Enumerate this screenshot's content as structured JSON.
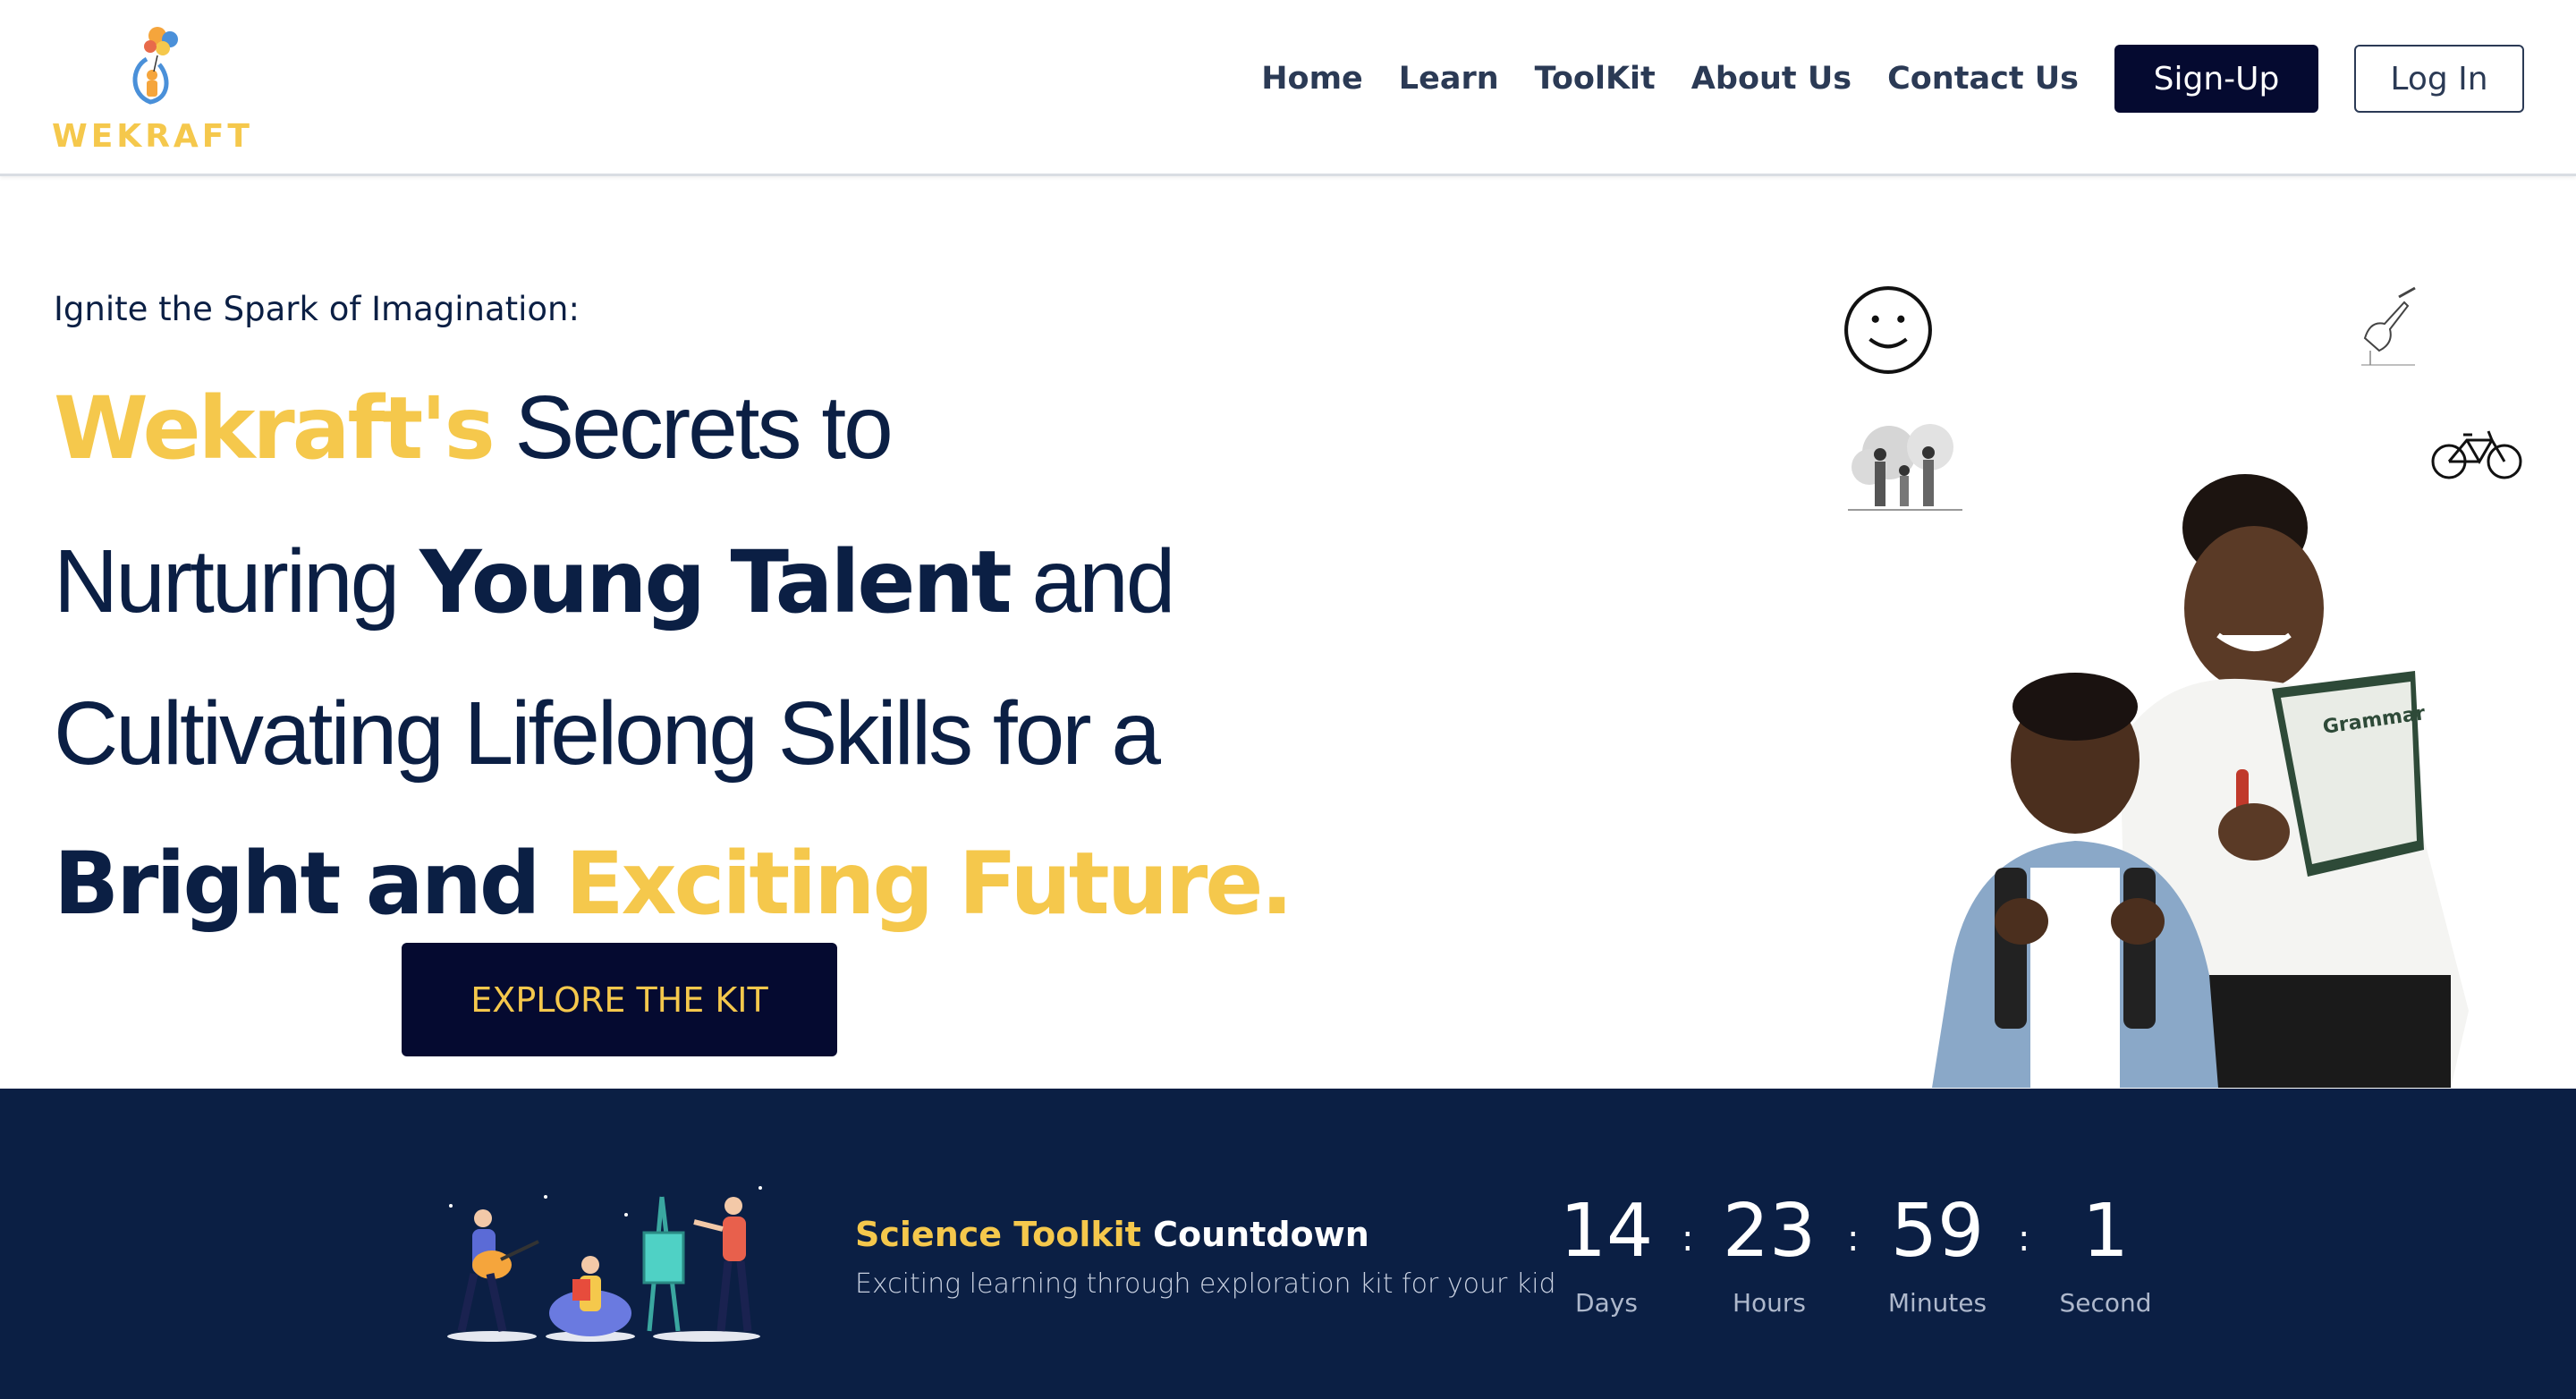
{
  "brand": {
    "name": "WEKRAFT",
    "logo_icon": "balloon-kid-icon"
  },
  "nav": {
    "links": [
      "Home",
      "Learn",
      "ToolKit",
      "About Us",
      "Contact Us"
    ],
    "signup_label": "Sign-Up",
    "login_label": "Log In"
  },
  "hero": {
    "tagline": "Ignite the Spark of Imagination:",
    "line1": {
      "highlight": "Wekraft's",
      "rest": " Secrets to"
    },
    "line2": {
      "prefix": "Nurturing ",
      "bold": "Young Talent",
      "suffix": " and"
    },
    "line3": "Cultivating Lifelong Skills for a",
    "line4": {
      "bold": "Bright and ",
      "highlight": "Exciting Future."
    },
    "cta_label": "EXPLORE THE KIT",
    "icons": [
      "smiley-icon",
      "family-icon",
      "writing-hand-icon",
      "bicycle-icon"
    ]
  },
  "countdown": {
    "title_highlight": "Science Toolkit",
    "title_rest": " Countdown",
    "subtitle": "Exciting learning through exploration kit for your kid",
    "separator": ":",
    "units": [
      {
        "value": "14",
        "label": "Days"
      },
      {
        "value": "23",
        "label": "Hours"
      },
      {
        "value": "59",
        "label": "Minutes"
      },
      {
        "value": "1",
        "label": "Second"
      }
    ]
  },
  "colors": {
    "navy": "#0b1f44",
    "dark_button": "#050a30",
    "yellow": "#f5c84c"
  }
}
